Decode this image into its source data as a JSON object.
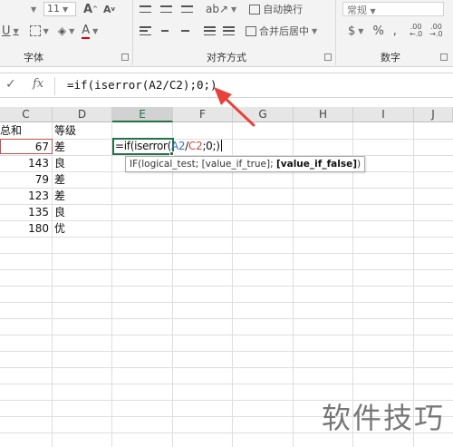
{
  "ribbon": {
    "font_size_value": "11",
    "font_grow_label": "A",
    "font_shrink_label": "A",
    "underline_label": "U",
    "font_color_label": "A",
    "wrap_text_label": "自动换行",
    "merge_center_label": "合并后居中",
    "number_format_value": "常规",
    "currency_label": "$",
    "percent_label": "%",
    "comma_label": ",",
    "decimal_increase_label": ".00",
    "decimal_decrease_label": ".00",
    "groups": {
      "font": "字体",
      "alignment": "对齐方式",
      "number": "数字"
    }
  },
  "formula_bar": {
    "confirm_symbol": "✓",
    "fx_label": "fx",
    "formula": "=if(iserror(A2/C2);0;)"
  },
  "grid": {
    "columns": [
      "C",
      "D",
      "E",
      "F",
      "G",
      "H",
      "I",
      "J"
    ],
    "selected_column": "E",
    "row1": {
      "c": "总和",
      "d": "等级"
    },
    "rows": [
      {
        "c": "67",
        "d": "差"
      },
      {
        "c": "143",
        "d": "良"
      },
      {
        "c": "79",
        "d": "差"
      },
      {
        "c": "123",
        "d": "差"
      },
      {
        "c": "135",
        "d": "良"
      },
      {
        "c": "180",
        "d": "优"
      }
    ],
    "active_cell_formula": {
      "prefix": "=if(iserror(",
      "ref1": "A2",
      "slash": "/",
      "ref2": "C2",
      "suffix": ";0;)"
    },
    "tooltip": {
      "text": "IF(logical_test; [value_if_true]; ",
      "bold": "[value_if_false]",
      "end": ")"
    }
  },
  "watermark": "软件技巧",
  "colors": {
    "accent": "#217346",
    "ref_blue": "#3f6ec2",
    "ref_red": "#c0504d",
    "arrow": "#e8413b"
  }
}
